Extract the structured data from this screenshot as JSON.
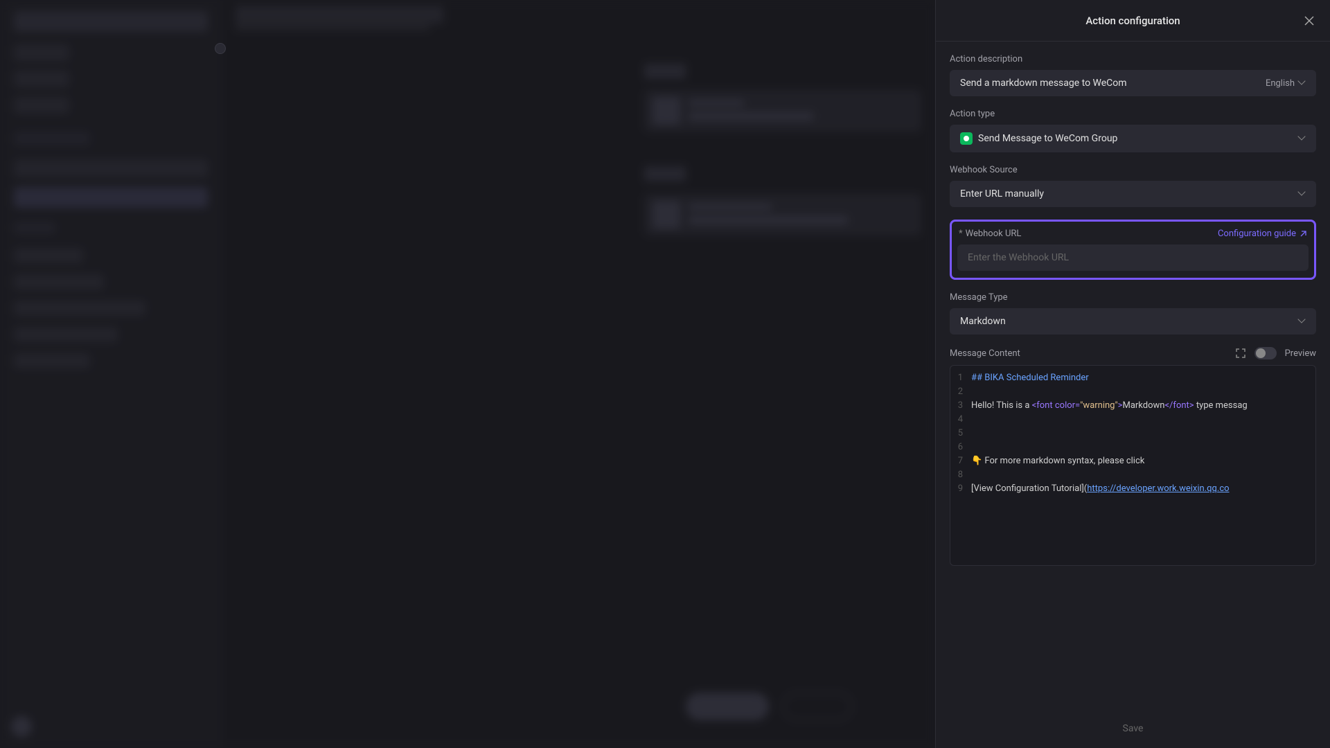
{
  "panel": {
    "title": "Action configuration",
    "action_description_label": "Action description",
    "action_description_value": "Send a markdown message to WeCom",
    "language": "English",
    "action_type_label": "Action type",
    "action_type_value": "Send Message to WeCom Group",
    "webhook_source_label": "Webhook Source",
    "webhook_source_value": "Enter URL manually",
    "webhook_url_label": "Webhook URL",
    "webhook_url_placeholder": "Enter the Webhook URL",
    "config_guide_label": "Configuration guide",
    "message_type_label": "Message Type",
    "message_type_value": "Markdown",
    "message_content_label": "Message Content",
    "preview_label": "Preview",
    "save_label": "Save"
  },
  "code": {
    "lines": [
      {
        "n": 1,
        "text_header": "## BIKA Scheduled Reminder"
      },
      {
        "n": 2,
        "text_plain": ""
      },
      {
        "n": 3,
        "prefix": "Hello! This is a ",
        "tag_open": "<font",
        "attr": " color=",
        "string": "\"warning\"",
        "tag_close_open": ">",
        "inner": "Markdown",
        "tag_close": "</font>",
        "suffix": " type messag"
      },
      {
        "n": 4,
        "text_plain": ""
      },
      {
        "n": 5,
        "text_plain": ""
      },
      {
        "n": 6,
        "text_plain": ""
      },
      {
        "n": 7,
        "emoji": "👇",
        "text_plain": " For more markdown syntax, please click"
      },
      {
        "n": 8,
        "text_plain": ""
      },
      {
        "n": 9,
        "bracket": "[View Configuration Tutorial](",
        "link": "https://developer.work.weixin.qq.co"
      }
    ]
  }
}
